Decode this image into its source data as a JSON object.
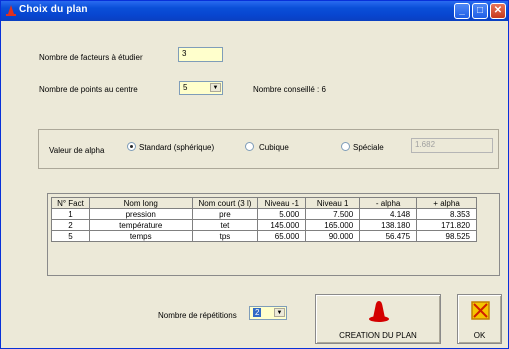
{
  "window": {
    "title": "Choix du plan",
    "minimize": "_",
    "maximize": "□",
    "close": "✕"
  },
  "form": {
    "facteurs_label": "Nombre de facteurs à étudier",
    "facteurs_value": "3",
    "points_label": "Nombre de points au centre",
    "points_value": "5",
    "conseil_label": "Nombre conseillé : 6"
  },
  "alpha": {
    "label": "Valeur de alpha",
    "options": [
      "Standard (sphérique)",
      "Cubique",
      "Spéciale"
    ],
    "selected": "Standard (sphérique)",
    "special_value": "1.682"
  },
  "table": {
    "headers": [
      "N° Fact",
      "Nom long",
      "Nom court (3 l)",
      "Niveau -1",
      "Niveau 1",
      "- alpha",
      "+ alpha"
    ],
    "rows": [
      [
        "1",
        "pression",
        "pre",
        "5.000",
        "7.500",
        "4.148",
        "8.353"
      ],
      [
        "2",
        "température",
        "tet",
        "145.000",
        "165.000",
        "138.180",
        "171.820"
      ],
      [
        "5",
        "temps",
        "tps",
        "65.000",
        "90.000",
        "56.475",
        "98.525"
      ]
    ]
  },
  "footer": {
    "repetitions_label": "Nombre de répétitions",
    "repetitions_value": "2",
    "create_button": "CREATION DU PLAN",
    "ok_button": "OK"
  },
  "colors": {
    "titlebar": "#0a4fd8",
    "window_bg": "#ece9d8",
    "input_bg": "#ffffcc",
    "cone_red": "#d40000",
    "ok_icon": "#f0c000"
  }
}
